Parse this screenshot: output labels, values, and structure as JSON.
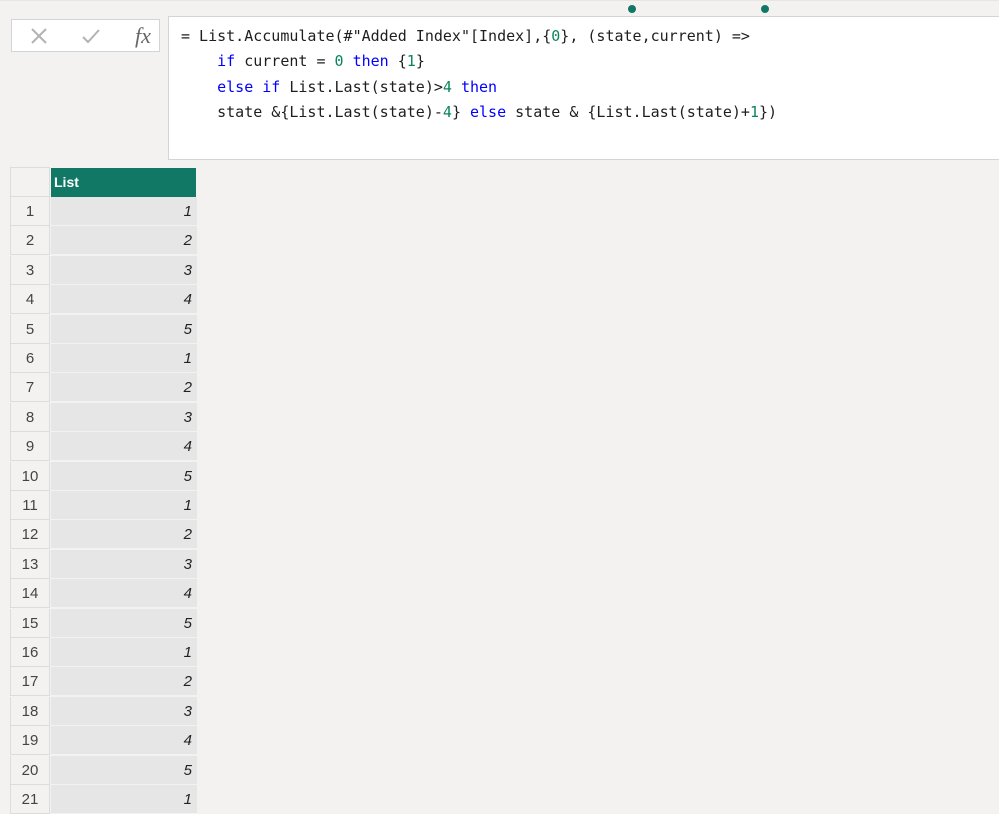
{
  "colors": {
    "accent": "#117865",
    "keyword": "#0000ff",
    "number": "#098658"
  },
  "formula_bar": {
    "cancel_icon": "close-icon",
    "commit_icon": "check-icon",
    "fx_label": "fx",
    "lines": [
      [
        {
          "t": "= List.Accumulate(#\"Added Index\"[Index],{",
          "c": ""
        },
        {
          "t": "0",
          "c": "num"
        },
        {
          "t": "}, (state,current) =>",
          "c": ""
        }
      ],
      [
        {
          "t": "    ",
          "c": ""
        },
        {
          "t": "if",
          "c": "kw"
        },
        {
          "t": " current = ",
          "c": ""
        },
        {
          "t": "0",
          "c": "num"
        },
        {
          "t": " ",
          "c": ""
        },
        {
          "t": "then",
          "c": "kw"
        },
        {
          "t": " {",
          "c": ""
        },
        {
          "t": "1",
          "c": "num"
        },
        {
          "t": "}",
          "c": ""
        }
      ],
      [
        {
          "t": "    ",
          "c": ""
        },
        {
          "t": "else if",
          "c": "kw"
        },
        {
          "t": " List.Last(state)>",
          "c": ""
        },
        {
          "t": "4",
          "c": "num"
        },
        {
          "t": " ",
          "c": ""
        },
        {
          "t": "then",
          "c": "kw"
        }
      ],
      [
        {
          "t": "    state &{List.Last(state)-",
          "c": ""
        },
        {
          "t": "4",
          "c": "num"
        },
        {
          "t": "} ",
          "c": ""
        },
        {
          "t": "else",
          "c": "kw"
        },
        {
          "t": " state & {List.Last(state)+",
          "c": ""
        },
        {
          "t": "1",
          "c": "num"
        },
        {
          "t": "})",
          "c": ""
        }
      ]
    ]
  },
  "table": {
    "column_header": "List",
    "rows": [
      {
        "n": "1",
        "v": "1"
      },
      {
        "n": "2",
        "v": "2"
      },
      {
        "n": "3",
        "v": "3"
      },
      {
        "n": "4",
        "v": "4"
      },
      {
        "n": "5",
        "v": "5"
      },
      {
        "n": "6",
        "v": "1"
      },
      {
        "n": "7",
        "v": "2"
      },
      {
        "n": "8",
        "v": "3"
      },
      {
        "n": "9",
        "v": "4"
      },
      {
        "n": "10",
        "v": "5"
      },
      {
        "n": "11",
        "v": "1"
      },
      {
        "n": "12",
        "v": "2"
      },
      {
        "n": "13",
        "v": "3"
      },
      {
        "n": "14",
        "v": "4"
      },
      {
        "n": "15",
        "v": "5"
      },
      {
        "n": "16",
        "v": "1"
      },
      {
        "n": "17",
        "v": "2"
      },
      {
        "n": "18",
        "v": "3"
      },
      {
        "n": "19",
        "v": "4"
      },
      {
        "n": "20",
        "v": "5"
      },
      {
        "n": "21",
        "v": "1"
      }
    ]
  }
}
